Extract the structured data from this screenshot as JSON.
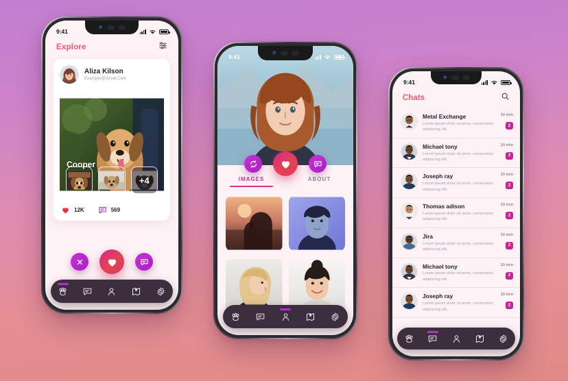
{
  "background": {
    "gradient_top": "#c27ed1",
    "gradient_bottom": "#e08a87"
  },
  "theme": {
    "accent_pink": "#ef5a6a",
    "accent_magenta": "#d5308f",
    "accent_purple": "#b52fd0",
    "nav_bg": "#3c2e3d",
    "badge": "#c5268f"
  },
  "phone1": {
    "status": {
      "time": "9:41",
      "signal_icon": "signal-icon",
      "wifi_icon": "wifi-icon",
      "battery_icon": "battery-icon"
    },
    "header": {
      "title": "Explore",
      "filter_icon": "filter-icon"
    },
    "card": {
      "user": {
        "name": "Aliza Kilson",
        "email": "Example@Gmail.Com",
        "avatar": "user-avatar"
      },
      "pet_name": "Cooper",
      "thumbs": [
        {
          "name": "thumb-photo-1",
          "overlay": ""
        },
        {
          "name": "thumb-photo-2",
          "overlay": ""
        },
        {
          "name": "thumb-photo-3",
          "overlay": "+4"
        }
      ],
      "stats": [
        {
          "icon": "heart-icon",
          "value": "12K"
        },
        {
          "icon": "comment-icon",
          "value": "569"
        }
      ]
    },
    "actions": [
      {
        "name": "dismiss-button",
        "icon": "close-icon",
        "size": "small"
      },
      {
        "name": "like-button",
        "icon": "heart-icon",
        "size": "big"
      },
      {
        "name": "message-button",
        "icon": "chat-icon",
        "size": "small"
      }
    ],
    "nav": {
      "active_index": 0,
      "items": [
        {
          "name": "nav-paw",
          "icon": "paw-icon"
        },
        {
          "name": "nav-chat",
          "icon": "chat-icon"
        },
        {
          "name": "nav-profile",
          "icon": "person-icon"
        },
        {
          "name": "nav-map",
          "icon": "map-pin-icon"
        },
        {
          "name": "nav-settings",
          "icon": "gear-icon"
        }
      ]
    }
  },
  "phone2": {
    "status": {
      "time": "9:41",
      "signal_icon": "signal-icon",
      "wifi_icon": "wifi-icon",
      "battery_icon": "battery-icon"
    },
    "photo": "profile-hero-photo",
    "actions": [
      {
        "name": "refresh-button",
        "icon": "refresh-icon",
        "size": "small"
      },
      {
        "name": "like-button",
        "icon": "heart-icon",
        "size": "big"
      },
      {
        "name": "message-button",
        "icon": "chat-icon",
        "size": "small"
      }
    ],
    "tabs": [
      {
        "label": "IMAGES",
        "active": true
      },
      {
        "label": "ABOUT",
        "active": false
      }
    ],
    "grid": [
      {
        "name": "grid-photo-1"
      },
      {
        "name": "grid-photo-2"
      },
      {
        "name": "grid-photo-3"
      },
      {
        "name": "grid-photo-4"
      }
    ],
    "nav": {
      "active_index": 2,
      "items": [
        {
          "name": "nav-paw",
          "icon": "paw-icon"
        },
        {
          "name": "nav-chat",
          "icon": "chat-icon"
        },
        {
          "name": "nav-profile",
          "icon": "person-icon"
        },
        {
          "name": "nav-map",
          "icon": "map-pin-icon"
        },
        {
          "name": "nav-settings",
          "icon": "gear-icon"
        }
      ]
    }
  },
  "phone3": {
    "status": {
      "time": "9:41",
      "signal_icon": "signal-icon",
      "wifi_icon": "wifi-icon",
      "battery_icon": "battery-icon"
    },
    "header": {
      "title": "Chats",
      "search_icon": "search-icon"
    },
    "chats": [
      {
        "name": "Metal Exchange",
        "message": "Lorem ipsum dolor sit amet, consectetur adipiscing elit,",
        "time": "10 min",
        "badge": "2"
      },
      {
        "name": "Michael tony",
        "message": "Lorem ipsum dolor sit amet, consectetur adipiscing elit,",
        "time": "10 min",
        "badge": "2"
      },
      {
        "name": "Joseph ray",
        "message": "Lorem ipsum dolor sit amet, consectetur adipiscing elit,",
        "time": "10 min",
        "badge": "2"
      },
      {
        "name": "Thomas  adison",
        "message": "Lorem ipsum dolor sit amet, consectetur adipiscing elit,",
        "time": "10 min",
        "badge": "2"
      },
      {
        "name": "Jira",
        "message": "Lorem ipsum dolor sit amet, consectetur adipiscing elit,",
        "time": "10 min",
        "badge": "2"
      },
      {
        "name": "Michael tony",
        "message": "Lorem ipsum dolor sit amet, consectetur adipiscing elit,",
        "time": "10 min",
        "badge": "2"
      },
      {
        "name": "Joseph ray",
        "message": "Lorem ipsum dolor sit amet, consectetur adipiscing elit,",
        "time": "10 min",
        "badge": "2"
      }
    ],
    "nav": {
      "active_index": 1,
      "items": [
        {
          "name": "nav-paw",
          "icon": "paw-icon"
        },
        {
          "name": "nav-chat",
          "icon": "chat-icon"
        },
        {
          "name": "nav-profile",
          "icon": "person-icon"
        },
        {
          "name": "nav-map",
          "icon": "map-pin-icon"
        },
        {
          "name": "nav-settings",
          "icon": "gear-icon"
        }
      ]
    }
  }
}
